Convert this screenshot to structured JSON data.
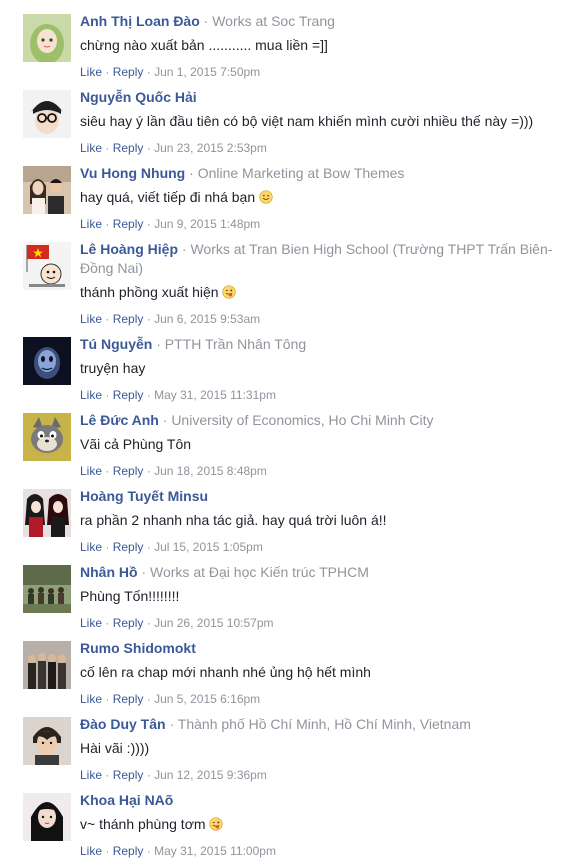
{
  "comments": [
    {
      "author": "Anh Thị Loan Đào",
      "meta": "Works at Soc Trang",
      "text": "chừng nào xuất bản ........... mua liền =]]",
      "emoji": "",
      "like": "Like",
      "reply": "Reply",
      "date": "Jun 1, 2015 7:50pm",
      "avatar": {
        "bg": "#c9d9a8",
        "fg": "#7fa14f",
        "icon": "anime-girl-avatar"
      }
    },
    {
      "author": "Nguyễn Quốc Hải",
      "meta": "",
      "text": "siêu hay ý lần đầu tiên có bộ việt nam khiến mình cười nhiều thế này =)))",
      "emoji": "",
      "like": "Like",
      "reply": "Reply",
      "date": "Jun 23, 2015 2:53pm",
      "avatar": {
        "bg": "#f2f2f2",
        "fg": "#222222",
        "icon": "glasses-avatar"
      }
    },
    {
      "author": "Vu Hong Nhung",
      "meta": "Online Marketing at Bow Themes",
      "text": "hay quá, viết tiếp đi nhá bạn",
      "emoji": "smile",
      "like": "Like",
      "reply": "Reply",
      "date": "Jun 9, 2015 1:48pm",
      "avatar": {
        "bg": "#d9c4b0",
        "fg": "#3a2a20",
        "icon": "couple-photo-avatar"
      }
    },
    {
      "author": "Lê Hoàng Hiệp",
      "meta": "Works at Tran Bien High School (Trường THPT Trấn Biên-Đồng Nai)",
      "text": "thánh phồng xuất hiện",
      "emoji": "tongue",
      "like": "Like",
      "reply": "Reply",
      "date": "Jun 6, 2015 9:53am",
      "avatar": {
        "bg": "#f4f4f4",
        "fg": "#d52b1e",
        "icon": "flag-cartoon-avatar"
      }
    },
    {
      "author": "Tú Nguyễn",
      "meta": "PTTH Trần Nhân Tông",
      "text": "truyện hay",
      "emoji": "",
      "like": "Like",
      "reply": "Reply",
      "date": "May 31, 2015 11:31pm",
      "avatar": {
        "bg": "#0c1020",
        "fg": "#6a86c0",
        "icon": "dark-creature-avatar"
      }
    },
    {
      "author": "Lê Đức Anh",
      "meta": "University of Economics, Ho Chi Minh City",
      "text": "Vãi cả Phùng Tôn",
      "emoji": "",
      "like": "Like",
      "reply": "Reply",
      "date": "Jun 18, 2015 8:48pm",
      "avatar": {
        "bg": "#c8b24a",
        "fg": "#5b5b5b",
        "icon": "cartoon-cat-avatar"
      }
    },
    {
      "author": "Hoàng Tuyết Minsu",
      "meta": "",
      "text": "ra phần 2 nhanh nha tác giả. hay quá trời luôn á!!",
      "emoji": "",
      "like": "Like",
      "reply": "Reply",
      "date": "Jul 15, 2015 1:05pm",
      "avatar": {
        "bg": "#e8e0e0",
        "fg": "#b0192a",
        "icon": "anime-pair-avatar"
      }
    },
    {
      "author": "Nhân Hồ",
      "meta": "Works at Đại học Kiến trúc TPHCM",
      "text": "Phùng Tốn!!!!!!!!",
      "emoji": "",
      "like": "Like",
      "reply": "Reply",
      "date": "Jun 26, 2015 10:57pm",
      "avatar": {
        "bg": "#5d6b4a",
        "fg": "#2f3a24",
        "icon": "group-outdoor-avatar"
      }
    },
    {
      "author": "Rumo Shidomokt",
      "meta": "",
      "text": "cố lên ra chap mới nhanh nhé ủng hộ hết mình",
      "emoji": "",
      "like": "Like",
      "reply": "Reply",
      "date": "Jun 5, 2015 6:16pm",
      "avatar": {
        "bg": "#b8b0a8",
        "fg": "#3a3430",
        "icon": "band-photo-avatar"
      }
    },
    {
      "author": "Đào Duy Tân",
      "meta": "Thành phố Hồ Chí Minh, Hồ Chí Minh, Vietnam",
      "text": "Hài vãi :))))",
      "emoji": "",
      "like": "Like",
      "reply": "Reply",
      "date": "Jun 12, 2015 9:36pm",
      "avatar": {
        "bg": "#dcd4cc",
        "fg": "#2a2420",
        "icon": "young-man-avatar"
      }
    },
    {
      "author": "Khoa Hại NAõ",
      "meta": "",
      "text": "v~ thánh phùng tơm",
      "emoji": "tongue",
      "like": "Like",
      "reply": "Reply",
      "date": "May 31, 2015 11:00pm",
      "avatar": {
        "bg": "#f0ecec",
        "fg": "#111111",
        "icon": "dark-hair-girl-avatar"
      }
    }
  ]
}
